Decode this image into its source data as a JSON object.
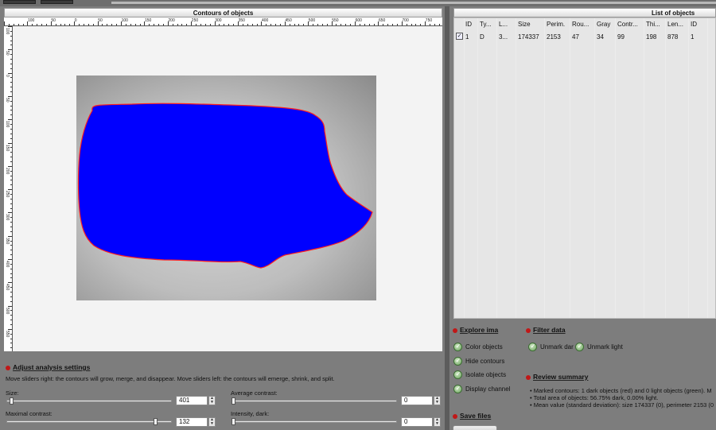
{
  "contours_panel": {
    "title": "Contours of objects",
    "top_ticks": [
      "100",
      "50",
      "0",
      "50",
      "100",
      "150",
      "200",
      "250",
      "300",
      "350",
      "400",
      "450",
      "500",
      "550",
      "600",
      "650",
      "700",
      "750"
    ],
    "left_ticks": [
      "100",
      "50",
      "0",
      "50",
      "100",
      "150",
      "200",
      "250",
      "300",
      "350",
      "400",
      "450",
      "500",
      "550"
    ]
  },
  "list_panel": {
    "title": "List of objects",
    "columns": [
      "ID",
      "Ty...",
      "L...",
      "Size",
      "Perim.",
      "Rou...",
      "Gray",
      "Contr...",
      "Thi...",
      "Len...",
      "ID"
    ],
    "rows": [
      {
        "checked": true,
        "cells": [
          "1",
          "D",
          "3...",
          "174337",
          "2153",
          "47",
          "34",
          "99",
          "198",
          "878",
          "1"
        ]
      }
    ]
  },
  "explore": {
    "title": "Explore ima",
    "options": [
      "Color objects",
      "Hide contours",
      "Isolate objects",
      "Display channel"
    ]
  },
  "filter": {
    "title": "Filter data",
    "options": [
      "Unmark dar",
      "Unmark light"
    ]
  },
  "review": {
    "title": "Review summary",
    "lines": [
      "• Marked contours: 1 dark objects (red) and 0 light objects (green). M",
      "• Total area of objects: 56.75% dark, 0.00% light.",
      "• Mean value (standard deviation): size 174337 (0), perimeter 2153 (0"
    ]
  },
  "save": {
    "title": "Save files"
  },
  "analysis": {
    "title": "Adjust analysis settings",
    "hint": "Move sliders right: the contours will grow, merge, and disappear. Move sliders left: the contours will emerge, shrink, and split.",
    "size_label": "Size:",
    "size_value": "401",
    "size_fraction": 0.02,
    "avg_contrast_label": "Average contrast:",
    "avg_contrast_value": "0",
    "avg_contrast_fraction": 0.0,
    "max_contrast_label": "Maximal contrast:",
    "max_contrast_value": "132",
    "max_contrast_fraction": 0.91,
    "intensity_label": "Intensity, dark:",
    "intensity_value": "0",
    "intensity_fraction": 0.0
  },
  "colors": {
    "object_fill": "#0000ff",
    "dark_contour": "#ff2020",
    "light_contour": "#00c000"
  }
}
